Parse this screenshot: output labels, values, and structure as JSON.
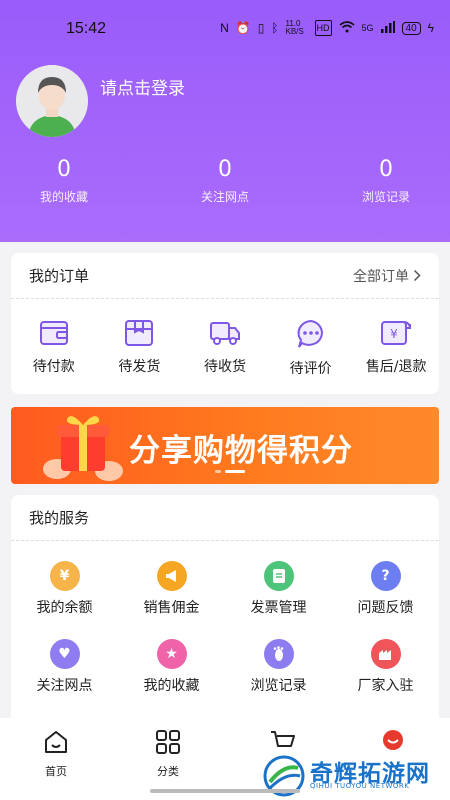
{
  "status": {
    "time": "15:42",
    "speed": "11.0 KB/S",
    "battery": "40",
    "hd": "HD",
    "net": "5G"
  },
  "profile": {
    "login_text": "请点击登录"
  },
  "stats": [
    {
      "num": "0",
      "label": "我的收藏"
    },
    {
      "num": "0",
      "label": "关注网点"
    },
    {
      "num": "0",
      "label": "浏览记录"
    }
  ],
  "orders": {
    "title": "我的订单",
    "all_link": "全部订单",
    "items": [
      {
        "label": "待付款",
        "icon": "wallet-icon"
      },
      {
        "label": "待发货",
        "icon": "package-icon"
      },
      {
        "label": "待收货",
        "icon": "truck-icon"
      },
      {
        "label": "待评价",
        "icon": "comment-icon"
      },
      {
        "label": "售后/退款",
        "icon": "refund-icon"
      }
    ]
  },
  "banner": {
    "text": "分享购物得积分"
  },
  "services": {
    "title": "我的服务",
    "items": [
      {
        "label": "我的余额",
        "icon": "money-bag-icon",
        "color": "#f7b44a"
      },
      {
        "label": "销售佣金",
        "icon": "megaphone-icon",
        "color": "#f5a623"
      },
      {
        "label": "发票管理",
        "icon": "invoice-icon",
        "color": "#4cc47a"
      },
      {
        "label": "问题反馈",
        "icon": "question-icon",
        "color": "#6c7ef0"
      },
      {
        "label": "关注网点",
        "icon": "heart-icon",
        "color": "#8e7cf0"
      },
      {
        "label": "我的收藏",
        "icon": "star-icon",
        "color": "#f063a8"
      },
      {
        "label": "浏览记录",
        "icon": "footprint-icon",
        "color": "#8b7cf0"
      },
      {
        "label": "厂家入驻",
        "icon": "factory-icon",
        "color": "#f0555a"
      }
    ]
  },
  "tabbar": [
    {
      "label": "首页",
      "icon": "home-icon"
    },
    {
      "label": "分类",
      "icon": "category-icon"
    },
    {
      "label": "",
      "icon": "cart-icon"
    },
    {
      "label": "",
      "icon": "profile-icon"
    }
  ],
  "watermark": {
    "text": "奇辉拓游网",
    "sub": "QIHUI TUOYOU NETWORK"
  },
  "colors": {
    "accent": "#9a5cfa",
    "order_icon": "#7e57e6",
    "banner": "#ff6a1f"
  }
}
